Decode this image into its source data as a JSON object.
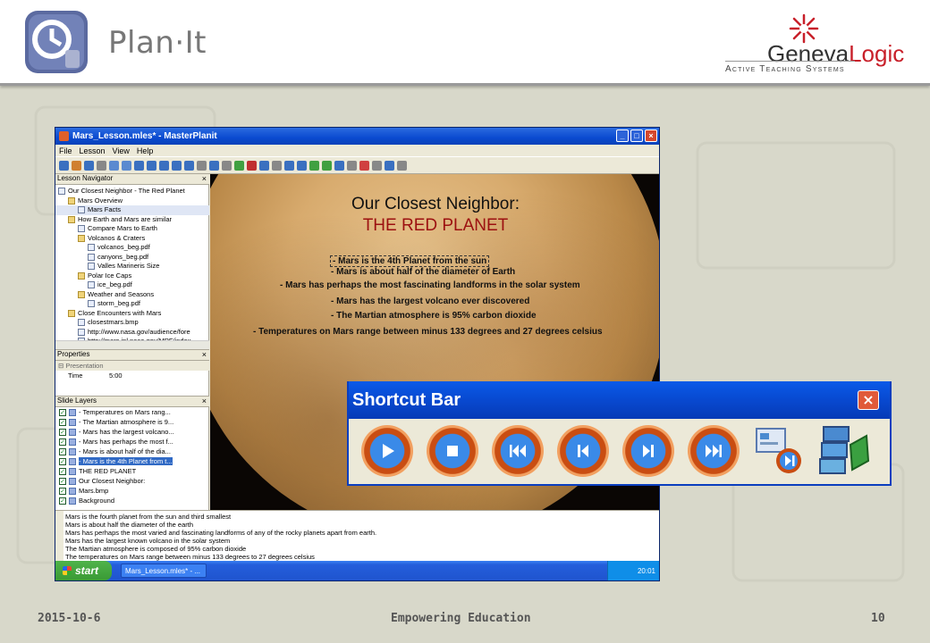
{
  "slide": {
    "brand_left": "Plan·It",
    "brand_right_dark": "Geneva",
    "brand_right_red": "Logic",
    "brand_right_sub": "Active Teaching Systems",
    "footer_date": "2015-10-6",
    "footer_middle": "Empowering Education",
    "footer_page": "10"
  },
  "window": {
    "title": "Mars_Lesson.mles* - MasterPlanit",
    "menu": [
      "File",
      "Lesson",
      "View",
      "Help"
    ],
    "navigator": {
      "header": "Lesson Navigator",
      "items": [
        {
          "label": "Our Closest Neighbor - The Red Planet",
          "indent": 0,
          "kind": "root"
        },
        {
          "label": "Mars Overview",
          "indent": 1,
          "kind": "folder"
        },
        {
          "label": "Mars Facts",
          "indent": 2,
          "kind": "slide",
          "selected": true
        },
        {
          "label": "How Earth and Mars are similar",
          "indent": 1,
          "kind": "folder"
        },
        {
          "label": "Compare Mars to Earth",
          "indent": 2,
          "kind": "slide"
        },
        {
          "label": "Volcanos & Craters",
          "indent": 2,
          "kind": "folder"
        },
        {
          "label": "volcanos_beg.pdf",
          "indent": 3,
          "kind": "file"
        },
        {
          "label": "canyons_beg.pdf",
          "indent": 3,
          "kind": "file"
        },
        {
          "label": "Valles Marineris Size",
          "indent": 3,
          "kind": "file"
        },
        {
          "label": "Polar Ice Caps",
          "indent": 2,
          "kind": "folder"
        },
        {
          "label": "ice_beg.pdf",
          "indent": 3,
          "kind": "file"
        },
        {
          "label": "Weather and Seasons",
          "indent": 2,
          "kind": "folder"
        },
        {
          "label": "storm_beg.pdf",
          "indent": 3,
          "kind": "file"
        },
        {
          "label": "Close Encounters with Mars",
          "indent": 1,
          "kind": "folder"
        },
        {
          "label": "closestmars.bmp",
          "indent": 2,
          "kind": "file"
        },
        {
          "label": "http://www.nasa.gov/audience/fore",
          "indent": 2,
          "kind": "file"
        },
        {
          "label": "http://mars.jpl.nasa.gov/MPF/index",
          "indent": 2,
          "kind": "file"
        }
      ]
    },
    "properties": {
      "header": "Properties",
      "group": "Presentation",
      "key": "Time",
      "value": "5:00"
    },
    "layers": {
      "header": "Slide Layers",
      "items": [
        "- Temperatures on Mars rang...",
        "- The Martian atmosphere is 9...",
        "- Mars has the largest volcano...",
        "- Mars has perhaps the most f...",
        "- Mars is about half of the dia...",
        "- Mars is the 4th Planet from t...",
        "THE RED PLANET",
        "Our Closest Neighbor:",
        "Mars.bmp",
        "Background"
      ],
      "highlighted_index": 5
    },
    "stage": {
      "title_line1": "Our Closest Neighbor:",
      "title_line2": "THE RED PLANET",
      "bullets": [
        "- Mars is the 4th Planet from the sun",
        "- Mars is about half of the diameter of Earth",
        "- Mars has perhaps the most fascinating landforms in the solar system",
        "- Mars has the largest volcano ever discovered",
        "- The Martian atmosphere is 95% carbon dioxide",
        "- Temperatures on Mars range between minus 133 degrees and 27 degrees celsius"
      ]
    },
    "notes": {
      "label": "Notes",
      "lines": [
        "Mars is the fourth planet from the sun and third smallest",
        "Mars is about half the diameter of the earth",
        "Mars has perhaps the most varied and fascinating landforms of any of the rocky planets apart from earth.",
        "Mars has the largest known volcano in the solar system",
        "The Martian atmosphere is composed of 95% carbon dioxide",
        "The temperatures on Mars range between minus 133 degrees to 27 degrees celsius"
      ]
    },
    "taskbar": {
      "start": "start",
      "task": "Mars_Lesson.mles* - ...",
      "clock": "20:01"
    }
  },
  "shortcut_bar": {
    "title": "Shortcut Bar",
    "buttons": [
      "play",
      "stop",
      "rewind",
      "previous",
      "next",
      "fast-forward",
      "slide-next",
      "layers"
    ],
    "colors": {
      "title_bg": "#0849d0",
      "button_inner": "#3a8ae8",
      "button_ring": "#c94d12"
    }
  }
}
